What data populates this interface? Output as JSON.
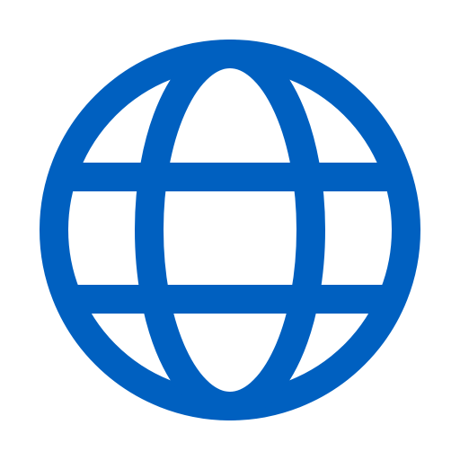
{
  "icon": {
    "name": "globe-icon",
    "color": "#0060C0",
    "background": "#FFFFFF"
  }
}
